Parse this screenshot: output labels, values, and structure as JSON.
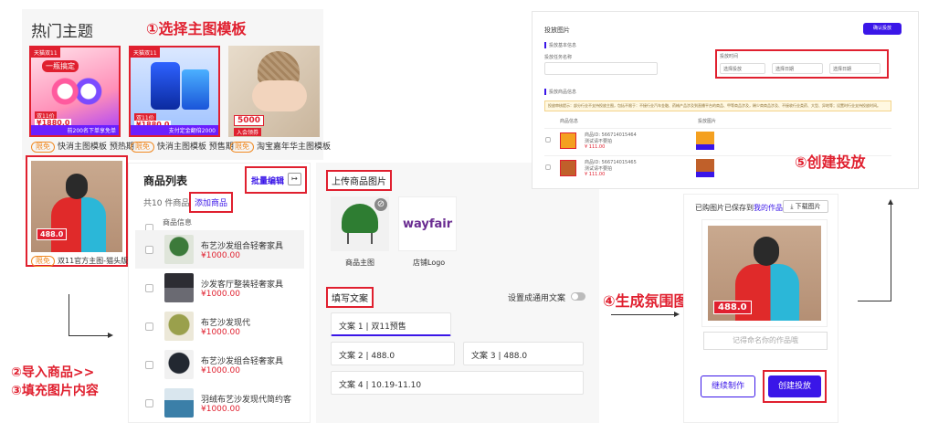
{
  "hot_themes": {
    "title": "热门主题",
    "templates": [
      {
        "tag": "限免",
        "name": "快消主图模板 预热期",
        "banner": "天猫双11",
        "line1": "一瓶搞定",
        "line2": "双11价",
        "price": "¥1880.0",
        "bottom": "前200名下单享免单"
      },
      {
        "tag": "限免",
        "name": "快消主图模板 预售期",
        "banner": "天猫双11",
        "line1": "",
        "line2": "双11价",
        "price": "¥1880.0",
        "bottom": "支付定金翻倍2000"
      },
      {
        "tag": "限免",
        "name": "淘宝嘉年华主图模板",
        "banner": "",
        "line1": "",
        "line2": "",
        "price": "5000",
        "bottom": "入会领券"
      }
    ],
    "selected_template": {
      "tag": "限免",
      "name": "双11官方主图-猫头版",
      "price": "488.0"
    }
  },
  "steps": {
    "s1": "①选择主图模板",
    "s2": "②导入商品>>",
    "s3": "③填充图片内容",
    "s4": "④生成氛围图",
    "s5": "⑤创建投放"
  },
  "product_list": {
    "title": "商品列表",
    "batch_edit": "批量编辑",
    "count_text": "共10 件商品",
    "add_button": "添加商品",
    "column_header": "商品信息",
    "items": [
      {
        "name": "布艺沙发组合轻奢家具",
        "price": "¥1000.00",
        "color": "#3c7a3a"
      },
      {
        "name": "沙发客厅整装轻奢家具",
        "price": "¥1000.00",
        "color": "#4a4a52"
      },
      {
        "name": "布艺沙发现代",
        "price": "¥1000.00",
        "color": "#9aa04c"
      },
      {
        "name": "布艺沙发组合轻奢家具",
        "price": "¥1000.00",
        "color": "#222831"
      },
      {
        "name": "羽绒布艺沙发现代简约客",
        "price": "¥1000.00",
        "color": "#3b7fa8"
      }
    ]
  },
  "upload": {
    "title": "上传商品图片",
    "main_image_label": "商品主图",
    "logo_label": "店铺Logo",
    "logo_text": "wayfair",
    "copy_title": "填写文案",
    "common_copy_label": "设置成通用文案",
    "copies": [
      "文案 1 | 双11预售",
      "文案 2 | 488.0",
      "文案 3 | 488.0",
      "文案 4 | 10.19-11.10"
    ]
  },
  "result": {
    "saved_text": "已购图片已保存到",
    "saved_link": "我的作品",
    "download": "下载图片",
    "price": "488.0",
    "name_placeholder": "记得命名你的作品哦",
    "continue_button": "继续制作",
    "create_button": "创建投放"
  },
  "placement": {
    "title": "投放图片",
    "confirm_button": "确认投放",
    "basic_info": "投放基本信息",
    "task_name_label": "投放任务名称",
    "time_label": "投放时间",
    "time_select": "选择投放",
    "start_date": "选择日期",
    "end_date": "选择日期",
    "product_info": "投放商品信息",
    "notice": "投放审核提示：部分行业不支持投放主图，包括不限于：不接行业汽车金融、药械产品涉及到直播平台的商品、甲等商品涉及，稀少商商品涉及、不接收行业类药、大型、异地等；设置时行业支持投放时间。",
    "col_product": "商品信息",
    "col_image": "投放图片",
    "rows": [
      {
        "id": "商品ID: 566714015464",
        "desc": "测试请不要拍",
        "price": "¥ 111.00"
      },
      {
        "id": "商品ID: 566714015465",
        "desc": "测试请不要拍",
        "price": "¥ 111.00"
      }
    ]
  }
}
